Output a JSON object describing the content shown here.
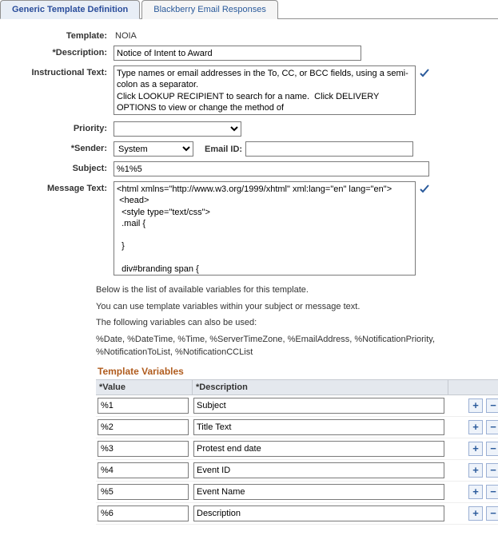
{
  "tabs": {
    "active": "Generic Template Definition",
    "inactive": "Blackberry Email Responses"
  },
  "labels": {
    "template": "Template:",
    "description": "*Description:",
    "instructional": "Instructional Text:",
    "priority": "Priority:",
    "sender": "*Sender:",
    "email_id": "Email ID:",
    "subject": "Subject:",
    "message_text": "Message Text:"
  },
  "values": {
    "template": "NOIA",
    "description": "Notice of Intent to Award",
    "instructional": "Type names or email addresses in the To, CC, or BCC fields, using a semi-colon as a separator.\nClick LOOKUP RECIPIENT to search for a name.  Click DELIVERY OPTIONS to view or change the method of",
    "priority": "",
    "sender": "System",
    "email_id": "",
    "subject": "%1%5",
    "message_text": "<html xmlns=\"http://www.w3.org/1999/xhtml\" xml:lang=\"en\" lang=\"en\">\n <head>\n  <style type=\"text/css\">\n  .mail {\n\n  }\n\n  div#branding span {\n   display: none;"
  },
  "priority_options": [
    ""
  ],
  "sender_options": [
    "System"
  ],
  "help": {
    "line1": "Below is the list of available variables for this template.",
    "line2": "You can use template variables within your subject or message text.",
    "line3": "The following variables can also be used:",
    "line4": "%Date, %DateTime, %Time, %ServerTimeZone, %EmailAddress, %NotificationPriority, %NotificationToList, %NotificationCCList"
  },
  "tv": {
    "title": "Template Variables",
    "col_value": "*Value",
    "col_desc": "*Description",
    "rows": [
      {
        "value": "%1",
        "desc": "Subject"
      },
      {
        "value": "%2",
        "desc": "Title Text"
      },
      {
        "value": "%3",
        "desc": "Protest end date"
      },
      {
        "value": "%4",
        "desc": "Event ID"
      },
      {
        "value": "%5",
        "desc": "Event Name"
      },
      {
        "value": "%6",
        "desc": "Description"
      }
    ]
  }
}
